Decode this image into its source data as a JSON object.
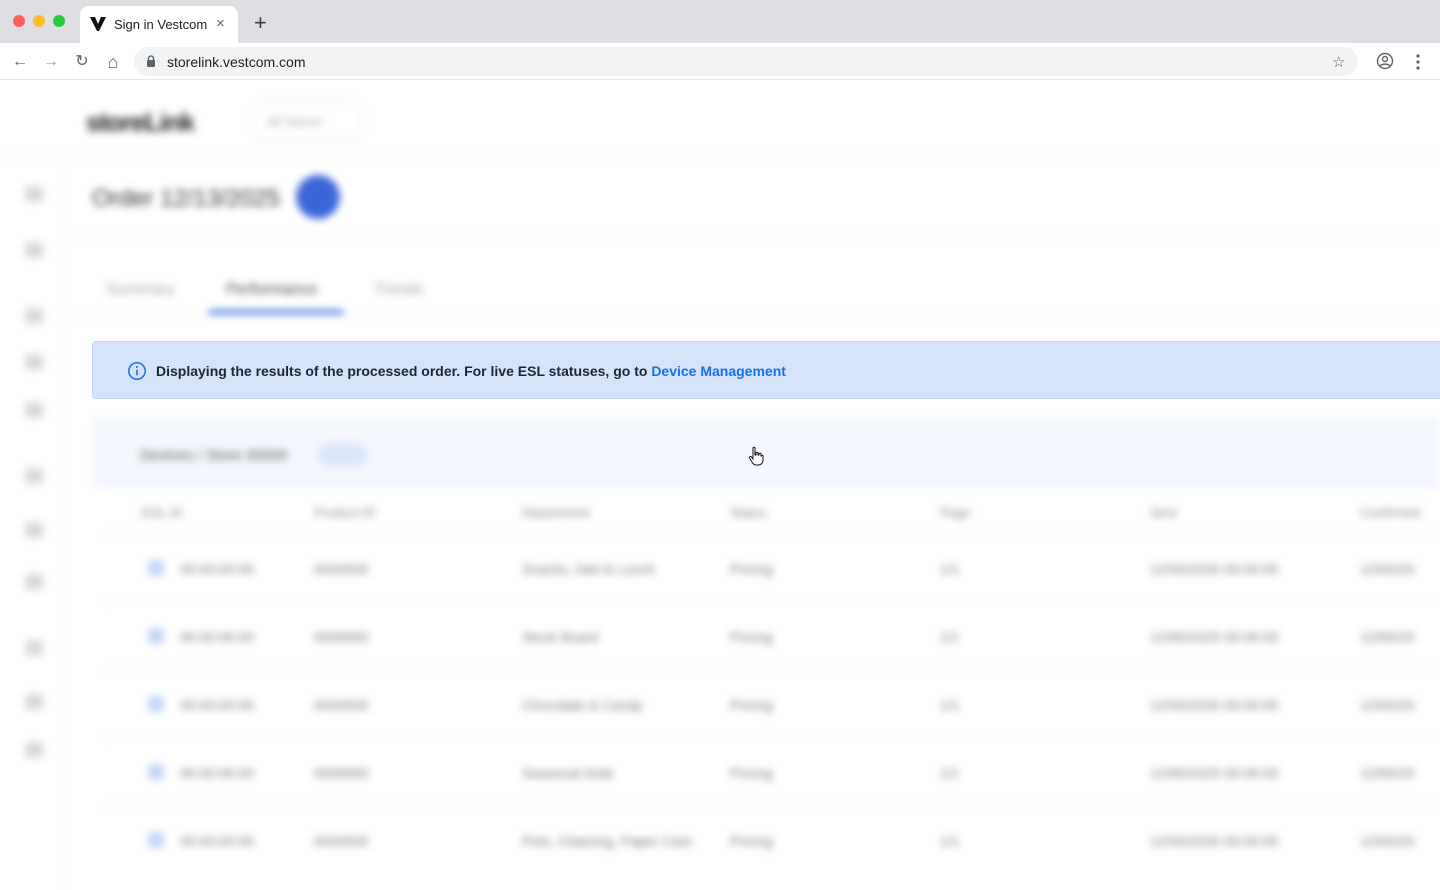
{
  "browser": {
    "tab_title": "Sign in Vestcom",
    "close_glyph": "×",
    "new_tab_glyph": "+",
    "url": "storelink.vestcom.com",
    "back_glyph": "←",
    "forward_glyph": "→",
    "reload_glyph": "↻",
    "home_glyph": "⌂",
    "star_glyph": "☆"
  },
  "app": {
    "logo": "storeLink",
    "store_selector": "All Stores",
    "page_title": "Order 12/13/2025",
    "tabs": [
      {
        "label": "Summary"
      },
      {
        "label": "Performance"
      },
      {
        "label": "Trends"
      }
    ],
    "section_label": "Devices / Store 00000",
    "table_headers": [
      "ESL ID",
      "Product ID",
      "Department",
      "Status",
      "Page",
      "Sent",
      "Confirmed"
    ],
    "rows": [
      {
        "esl": "00:00:00:00",
        "product": "0000000",
        "dept": "Snacks, Deli & Lunch",
        "status": "Pricing",
        "page": "1/1",
        "sent": "12/00/2025 00:00:00",
        "confirmed": "12/00/20"
      },
      {
        "esl": "00:00:00:00",
        "product": "0000000",
        "dept": "Stock Board",
        "status": "Pricing",
        "page": "1/1",
        "sent": "12/00/2025 00:00:00",
        "confirmed": "12/00/20"
      },
      {
        "esl": "00:00:00:00",
        "product": "0000000",
        "dept": "Chocolate & Candy",
        "status": "Pricing",
        "page": "1/1",
        "sent": "12/00/2025 00:00:00",
        "confirmed": "12/00/20"
      },
      {
        "esl": "00:00:00:00",
        "product": "0000000",
        "dept": "Seasonal Aisle",
        "status": "Pricing",
        "page": "1/1",
        "sent": "12/00/2025 00:00:00",
        "confirmed": "12/00/20"
      },
      {
        "esl": "00:00:00:00",
        "product": "0000000",
        "dept": "Pets, Cleaning, Paper Care",
        "status": "Pricing",
        "page": "1/1",
        "sent": "12/00/2025 00:00:00",
        "confirmed": "12/00/20"
      }
    ]
  },
  "banner": {
    "message": "Displaying the results of the processed order. For live ESL statuses, go to ",
    "link": "Device Management"
  },
  "colors": {
    "banner_bg": "#d6e4fb",
    "link": "#1a6fe8",
    "accent": "#2f6de0"
  }
}
